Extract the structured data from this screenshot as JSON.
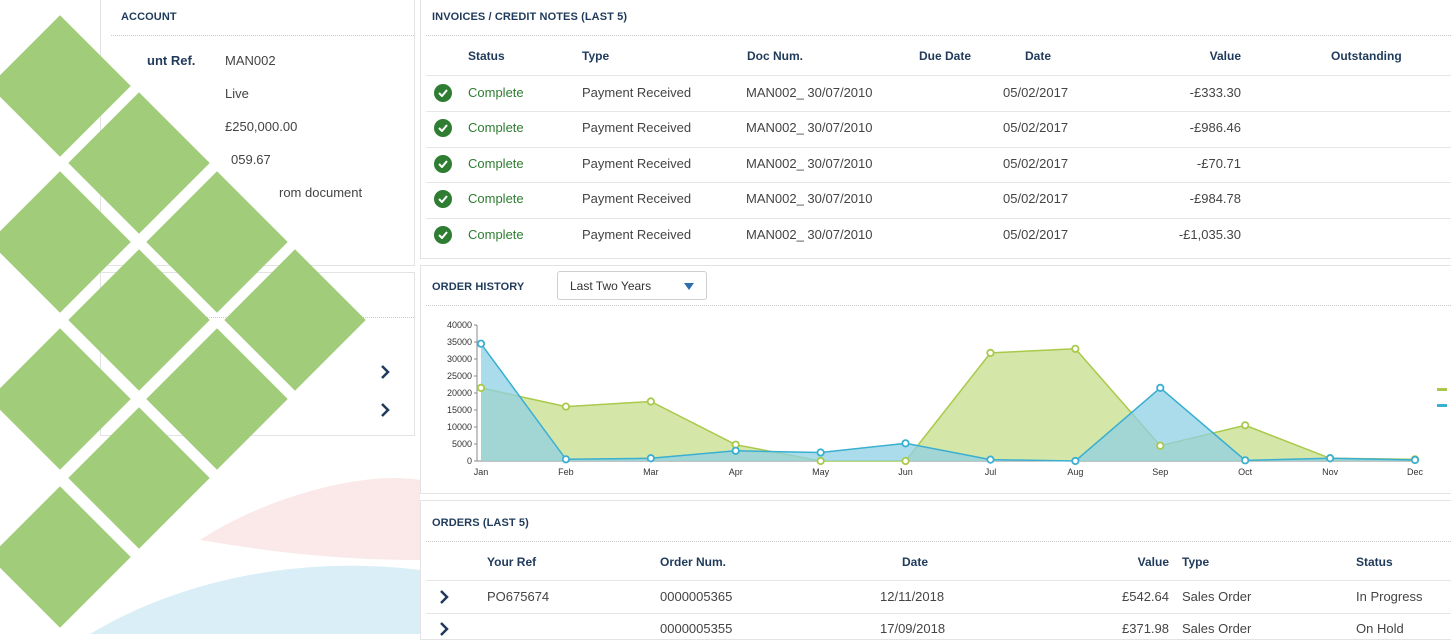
{
  "account": {
    "title": "ACCOUNT",
    "ref_label": "unt Ref.",
    "ref_value": "MAN002",
    "status_value": "Live",
    "limit_value": "£250,000.00",
    "balance_fragment": "059.67",
    "note_fragment": "rom document"
  },
  "invoices": {
    "title": "INVOICES / CREDIT NOTES (LAST 5)",
    "headers": [
      "Status",
      "Type",
      "Doc Num.",
      "Due Date",
      "Date",
      "Value",
      "Outstanding"
    ],
    "rows": [
      {
        "status": "Complete",
        "type": "Payment Received",
        "doc": "MAN002_ 30/07/2010",
        "due": "",
        "date": "05/02/2017",
        "value": "-£333.30",
        "outstanding": ""
      },
      {
        "status": "Complete",
        "type": "Payment Received",
        "doc": "MAN002_ 30/07/2010",
        "due": "",
        "date": "05/02/2017",
        "value": "-£986.46",
        "outstanding": ""
      },
      {
        "status": "Complete",
        "type": "Payment Received",
        "doc": "MAN002_ 30/07/2010",
        "due": "",
        "date": "05/02/2017",
        "value": "-£70.71",
        "outstanding": ""
      },
      {
        "status": "Complete",
        "type": "Payment Received",
        "doc": "MAN002_ 30/07/2010",
        "due": "",
        "date": "05/02/2017",
        "value": "-£984.78",
        "outstanding": ""
      },
      {
        "status": "Complete",
        "type": "Payment Received",
        "doc": "MAN002_ 30/07/2010",
        "due": "",
        "date": "05/02/2017",
        "value": "-£1,035.30",
        "outstanding": ""
      }
    ]
  },
  "order_history": {
    "title": "ORDER HISTORY",
    "range_selected": "Last Two Years"
  },
  "chart_data": {
    "type": "area",
    "categories": [
      "Jan",
      "Feb",
      "Mar",
      "Apr",
      "May",
      "Jun",
      "Jul",
      "Aug",
      "Sep",
      "Oct",
      "Nov",
      "Dec"
    ],
    "ylim": [
      0,
      40000
    ],
    "yticks": [
      0,
      5000,
      10000,
      15000,
      20000,
      25000,
      30000,
      35000,
      40000
    ],
    "grid": false,
    "series": [
      {
        "color": "#a9c94a",
        "fill": "#c7dd8c",
        "values": [
          21500,
          16000,
          17500,
          4800,
          0,
          0,
          31800,
          33000,
          4500,
          10500,
          800,
          500
        ]
      },
      {
        "color": "#3aafd0",
        "fill": "#8fd0e4",
        "values": [
          34500,
          500,
          800,
          3000,
          2500,
          5200,
          400,
          0,
          21500,
          200,
          800,
          300
        ]
      }
    ]
  },
  "orders": {
    "title": "ORDERS (LAST 5)",
    "headers": [
      "Your Ref",
      "Order Num.",
      "Date",
      "Value",
      "Type",
      "Status"
    ],
    "rows": [
      {
        "ref": "PO675674",
        "num": "0000005365",
        "date": "12/11/2018",
        "value": "£542.64",
        "type": "Sales Order",
        "status": "In Progress"
      },
      {
        "ref": "",
        "num": "0000005355",
        "date": "17/09/2018",
        "value": "£371.98",
        "type": "Sales Order",
        "status": "On Hold"
      }
    ]
  },
  "colors": {
    "heading": "#1f3a5a",
    "complete_green": "#2e7d32",
    "diamond_green": "#a1cc79"
  },
  "icons": [
    "check-circle-icon",
    "chevron-right-icon",
    "caret-down-icon"
  ]
}
